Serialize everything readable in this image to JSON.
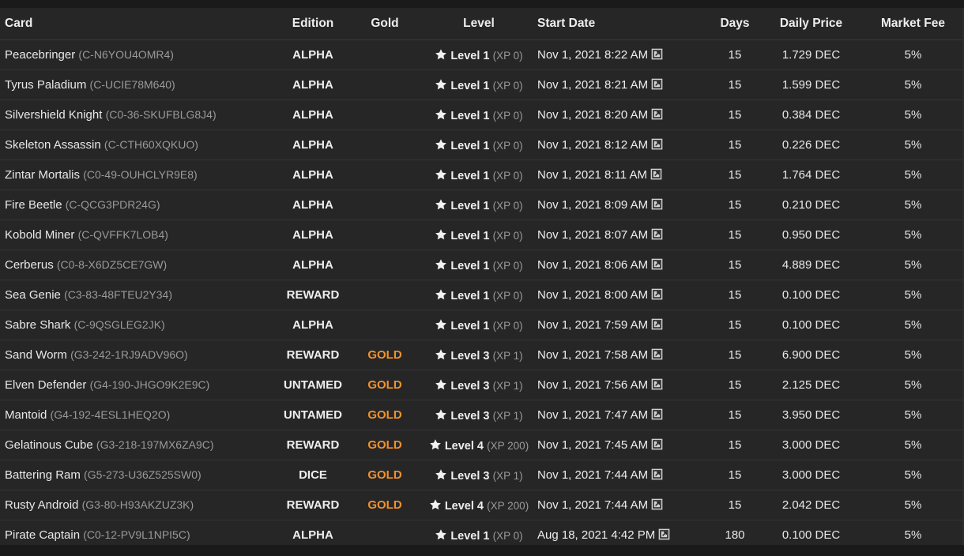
{
  "columns": {
    "card": "Card",
    "edition": "Edition",
    "gold": "Gold",
    "level": "Level",
    "start_date": "Start Date",
    "days": "Days",
    "daily_price": "Daily Price",
    "market_fee": "Market Fee"
  },
  "icons": {
    "star": "star-icon",
    "external_link": "external-link-icon"
  },
  "colors": {
    "gold": "#f0922e"
  },
  "rows": [
    {
      "name": "Peacebringer",
      "id": "(C-N6YOU4OMR4)",
      "edition": "ALPHA",
      "gold": "",
      "level": "Level 1",
      "xp": "(XP 0)",
      "date": "Nov 1, 2021 8:22 AM",
      "days": "15",
      "price": "1.729 DEC",
      "fee": "5%"
    },
    {
      "name": "Tyrus Paladium",
      "id": "(C-UCIE78M640)",
      "edition": "ALPHA",
      "gold": "",
      "level": "Level 1",
      "xp": "(XP 0)",
      "date": "Nov 1, 2021 8:21 AM",
      "days": "15",
      "price": "1.599 DEC",
      "fee": "5%"
    },
    {
      "name": "Silvershield Knight",
      "id": "(C0-36-SKUFBLG8J4)",
      "edition": "ALPHA",
      "gold": "",
      "level": "Level 1",
      "xp": "(XP 0)",
      "date": "Nov 1, 2021 8:20 AM",
      "days": "15",
      "price": "0.384 DEC",
      "fee": "5%"
    },
    {
      "name": "Skeleton Assassin",
      "id": "(C-CTH60XQKUO)",
      "edition": "ALPHA",
      "gold": "",
      "level": "Level 1",
      "xp": "(XP 0)",
      "date": "Nov 1, 2021 8:12 AM",
      "days": "15",
      "price": "0.226 DEC",
      "fee": "5%"
    },
    {
      "name": "Zintar Mortalis",
      "id": "(C0-49-OUHCLYR9E8)",
      "edition": "ALPHA",
      "gold": "",
      "level": "Level 1",
      "xp": "(XP 0)",
      "date": "Nov 1, 2021 8:11 AM",
      "days": "15",
      "price": "1.764 DEC",
      "fee": "5%"
    },
    {
      "name": "Fire Beetle",
      "id": "(C-QCG3PDR24G)",
      "edition": "ALPHA",
      "gold": "",
      "level": "Level 1",
      "xp": "(XP 0)",
      "date": "Nov 1, 2021 8:09 AM",
      "days": "15",
      "price": "0.210 DEC",
      "fee": "5%"
    },
    {
      "name": "Kobold Miner",
      "id": "(C-QVFFK7LOB4)",
      "edition": "ALPHA",
      "gold": "",
      "level": "Level 1",
      "xp": "(XP 0)",
      "date": "Nov 1, 2021 8:07 AM",
      "days": "15",
      "price": "0.950 DEC",
      "fee": "5%"
    },
    {
      "name": "Cerberus",
      "id": "(C0-8-X6DZ5CE7GW)",
      "edition": "ALPHA",
      "gold": "",
      "level": "Level 1",
      "xp": "(XP 0)",
      "date": "Nov 1, 2021 8:06 AM",
      "days": "15",
      "price": "4.889 DEC",
      "fee": "5%"
    },
    {
      "name": "Sea Genie",
      "id": "(C3-83-48FTEU2Y34)",
      "edition": "REWARD",
      "gold": "",
      "level": "Level 1",
      "xp": "(XP 0)",
      "date": "Nov 1, 2021 8:00 AM",
      "days": "15",
      "price": "0.100 DEC",
      "fee": "5%"
    },
    {
      "name": "Sabre Shark",
      "id": "(C-9QSGLEG2JK)",
      "edition": "ALPHA",
      "gold": "",
      "level": "Level 1",
      "xp": "(XP 0)",
      "date": "Nov 1, 2021 7:59 AM",
      "days": "15",
      "price": "0.100 DEC",
      "fee": "5%"
    },
    {
      "name": "Sand Worm",
      "id": "(G3-242-1RJ9ADV96O)",
      "edition": "REWARD",
      "gold": "GOLD",
      "level": "Level 3",
      "xp": "(XP 1)",
      "date": "Nov 1, 2021 7:58 AM",
      "days": "15",
      "price": "6.900 DEC",
      "fee": "5%"
    },
    {
      "name": "Elven Defender",
      "id": "(G4-190-JHGO9K2E9C)",
      "edition": "UNTAMED",
      "gold": "GOLD",
      "level": "Level 3",
      "xp": "(XP 1)",
      "date": "Nov 1, 2021 7:56 AM",
      "days": "15",
      "price": "2.125 DEC",
      "fee": "5%"
    },
    {
      "name": "Mantoid",
      "id": "(G4-192-4ESL1HEQ2O)",
      "edition": "UNTAMED",
      "gold": "GOLD",
      "level": "Level 3",
      "xp": "(XP 1)",
      "date": "Nov 1, 2021 7:47 AM",
      "days": "15",
      "price": "3.950 DEC",
      "fee": "5%"
    },
    {
      "name": "Gelatinous Cube",
      "id": "(G3-218-197MX6ZA9C)",
      "edition": "REWARD",
      "gold": "GOLD",
      "level": "Level 4",
      "xp": "(XP 200)",
      "date": "Nov 1, 2021 7:45 AM",
      "days": "15",
      "price": "3.000 DEC",
      "fee": "5%"
    },
    {
      "name": "Battering Ram",
      "id": "(G5-273-U36Z525SW0)",
      "edition": "DICE",
      "gold": "GOLD",
      "level": "Level 3",
      "xp": "(XP 1)",
      "date": "Nov 1, 2021 7:44 AM",
      "days": "15",
      "price": "3.000 DEC",
      "fee": "5%"
    },
    {
      "name": "Rusty Android",
      "id": "(G3-80-H93AKZUZ3K)",
      "edition": "REWARD",
      "gold": "GOLD",
      "level": "Level 4",
      "xp": "(XP 200)",
      "date": "Nov 1, 2021 7:44 AM",
      "days": "15",
      "price": "2.042 DEC",
      "fee": "5%"
    },
    {
      "name": "Pirate Captain",
      "id": "(C0-12-PV9L1NPI5C)",
      "edition": "ALPHA",
      "gold": "",
      "level": "Level 1",
      "xp": "(XP 0)",
      "date": "Aug 18, 2021 4:42 PM",
      "days": "180",
      "price": "0.100 DEC",
      "fee": "5%"
    }
  ]
}
